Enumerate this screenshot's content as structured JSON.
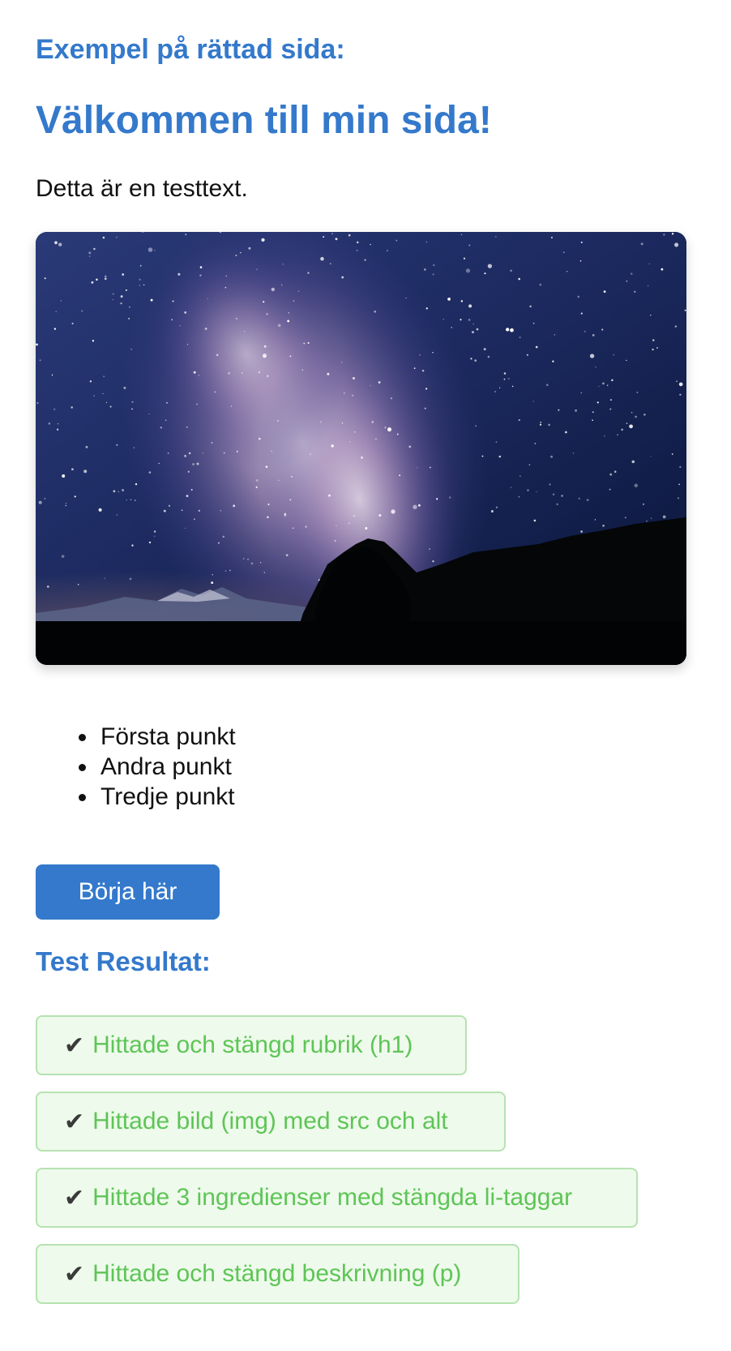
{
  "page": {
    "example_heading": "Exempel på rättad sida:",
    "title": "Välkommen till min sida!",
    "intro_text": "Detta är en testtext."
  },
  "hero_image": {
    "subject": "Milky Way night sky over mountains and tree silhouettes"
  },
  "list": {
    "items": [
      "Första punkt",
      "Andra punkt",
      "Tredje punkt"
    ]
  },
  "button": {
    "label": "Börja här"
  },
  "results": {
    "heading": "Test Resultat:",
    "check_glyph": "✔",
    "items": [
      "Hittade och stängd rubrik (h1)",
      "Hittade bild (img) med src och alt",
      "Hittade 3 ingredienser med stängda li-taggar",
      "Hittade och stängd beskrivning (p)"
    ]
  },
  "colors": {
    "accent": "#3479cb",
    "success_text": "#5ec557",
    "success_bg": "#eefaeb",
    "success_border": "#b6e2b1"
  }
}
